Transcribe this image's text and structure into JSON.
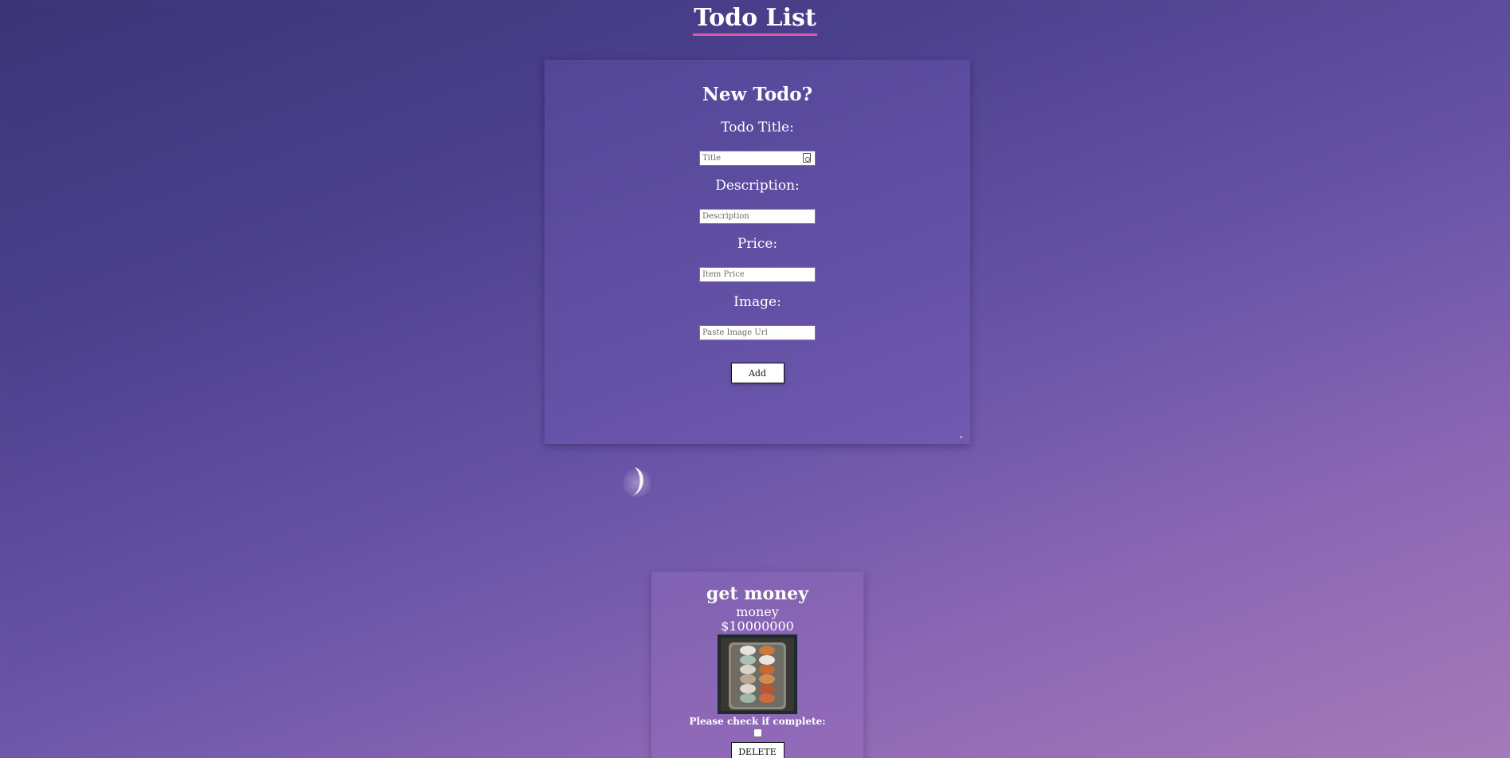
{
  "header": {
    "title": "Todo List"
  },
  "form": {
    "heading": "New Todo?",
    "fields": [
      {
        "label": "Todo Title:",
        "placeholder": "Title"
      },
      {
        "label": "Description:",
        "placeholder": "Description"
      },
      {
        "label": "Price:",
        "placeholder": "Item Price"
      },
      {
        "label": "Image:",
        "placeholder": "Paste Image Url"
      }
    ],
    "submit_label": "Add"
  },
  "todos": [
    {
      "title": "get money",
      "description": "money",
      "price": "$10000000",
      "complete_prompt": "Please check if complete:",
      "completed": false,
      "delete_label": "DELETE",
      "image_icon": "egg-carton-photo"
    }
  ],
  "colors": {
    "title_underline": "#e05aa8",
    "background_top": "#3b3577",
    "background_bottom": "#a67ab8"
  }
}
